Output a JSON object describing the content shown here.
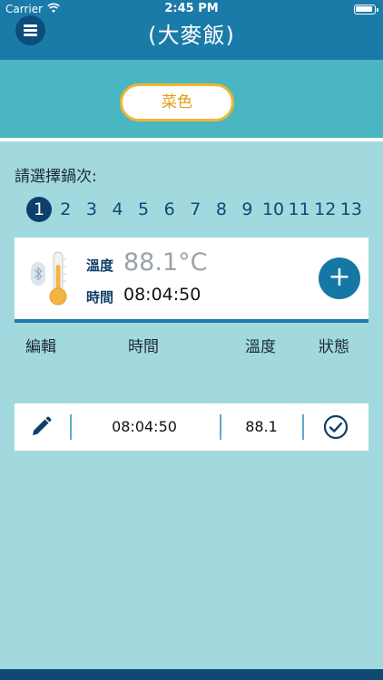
{
  "status_bar": {
    "carrier": "Carrier",
    "time": "2:45 PM"
  },
  "header": {
    "title": "(大麥飯)"
  },
  "band": {
    "pill_label": "菜色"
  },
  "batches": {
    "prompt": "請選擇鍋次:",
    "items": [
      "1",
      "2",
      "3",
      "4",
      "5",
      "6",
      "7",
      "8",
      "9",
      "10",
      "11",
      "12",
      "13"
    ],
    "selected": "1"
  },
  "reading": {
    "temp_label": "溫度",
    "temp_value": "88.1°C",
    "time_label": "時間",
    "time_value": "08:04:50",
    "add_symbol": "+"
  },
  "table": {
    "headers": [
      "編輯",
      "時間",
      "溫度",
      "狀態"
    ],
    "rows": [
      {
        "time": "08:04:50",
        "temp": "88.1"
      }
    ]
  },
  "colors": {
    "header": "#1a7aa8",
    "band": "#4ab6c2",
    "background": "#a2d9de",
    "accent": "#f1b530",
    "dark_blue": "#0e3f6a"
  }
}
